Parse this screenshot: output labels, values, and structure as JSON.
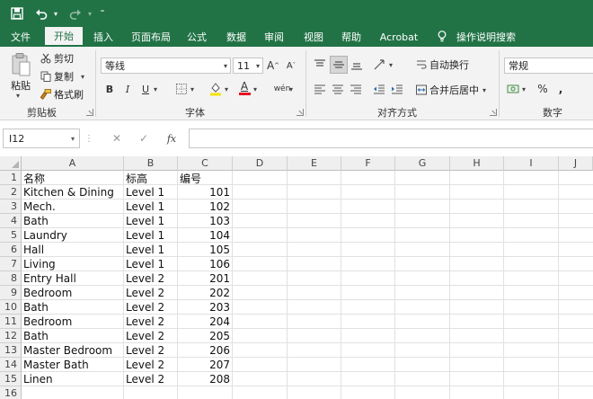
{
  "quick_access": {
    "save_icon": "save-icon",
    "undo_icon": "undo-icon",
    "redo_icon": "redo-icon",
    "customize_icon": "customize-icon"
  },
  "tabs": [
    {
      "label": "文件"
    },
    {
      "label": "开始"
    },
    {
      "label": "插入"
    },
    {
      "label": "页面布局"
    },
    {
      "label": "公式"
    },
    {
      "label": "数据"
    },
    {
      "label": "审阅"
    },
    {
      "label": "视图"
    },
    {
      "label": "帮助"
    },
    {
      "label": "Acrobat"
    },
    {
      "label": "操作说明搜索"
    }
  ],
  "ribbon": {
    "clipboard": {
      "paste": "粘贴",
      "cut": "剪切",
      "copy": "复制",
      "format_painter": "格式刷",
      "label": "剪贴板"
    },
    "font": {
      "name": "等线",
      "size": "11",
      "grow": "A",
      "shrink": "A",
      "bold": "B",
      "italic": "I",
      "underline": "U",
      "font_color_letter": "A",
      "phonetic": "wén",
      "label": "字体"
    },
    "alignment": {
      "wrap_text": "自动换行",
      "merge_center": "合并后居中",
      "label": "对齐方式"
    },
    "number": {
      "format": "常规",
      "percent": "%",
      "comma": ",",
      "label": "数字"
    }
  },
  "formula_bar": {
    "name_box": "I12",
    "cancel": "✕",
    "enter": "✓",
    "fx": "fx",
    "content": ""
  },
  "sheet": {
    "columns": [
      "A",
      "B",
      "C",
      "D",
      "E",
      "F",
      "G",
      "H",
      "I",
      "J"
    ],
    "rows": [
      {
        "num": "1",
        "a": "名称",
        "b": "标高",
        "c": "编号"
      },
      {
        "num": "2",
        "a": "Kitchen & Dining",
        "b": "Level 1",
        "c": "101"
      },
      {
        "num": "3",
        "a": "Mech.",
        "b": "Level 1",
        "c": "102"
      },
      {
        "num": "4",
        "a": "Bath",
        "b": "Level 1",
        "c": "103"
      },
      {
        "num": "5",
        "a": "Laundry",
        "b": "Level 1",
        "c": "104"
      },
      {
        "num": "6",
        "a": "Hall",
        "b": "Level 1",
        "c": "105"
      },
      {
        "num": "7",
        "a": "Living",
        "b": "Level 1",
        "c": "106"
      },
      {
        "num": "8",
        "a": "Entry Hall",
        "b": "Level 2",
        "c": "201"
      },
      {
        "num": "9",
        "a": "Bedroom",
        "b": "Level 2",
        "c": "202"
      },
      {
        "num": "10",
        "a": "Bath",
        "b": "Level 2",
        "c": "203"
      },
      {
        "num": "11",
        "a": "Bedroom",
        "b": "Level 2",
        "c": "204"
      },
      {
        "num": "12",
        "a": "Bath",
        "b": "Level 2",
        "c": "205"
      },
      {
        "num": "13",
        "a": "Master Bedroom",
        "b": "Level 2",
        "c": "206"
      },
      {
        "num": "14",
        "a": "Master Bath",
        "b": "Level 2",
        "c": "207"
      },
      {
        "num": "15",
        "a": "Linen",
        "b": "Level 2",
        "c": "208"
      },
      {
        "num": "16",
        "a": "",
        "b": "",
        "c": ""
      }
    ]
  },
  "colors": {
    "accent": "#217346",
    "highlight": "#f5e300",
    "font_color": "#e81123"
  }
}
